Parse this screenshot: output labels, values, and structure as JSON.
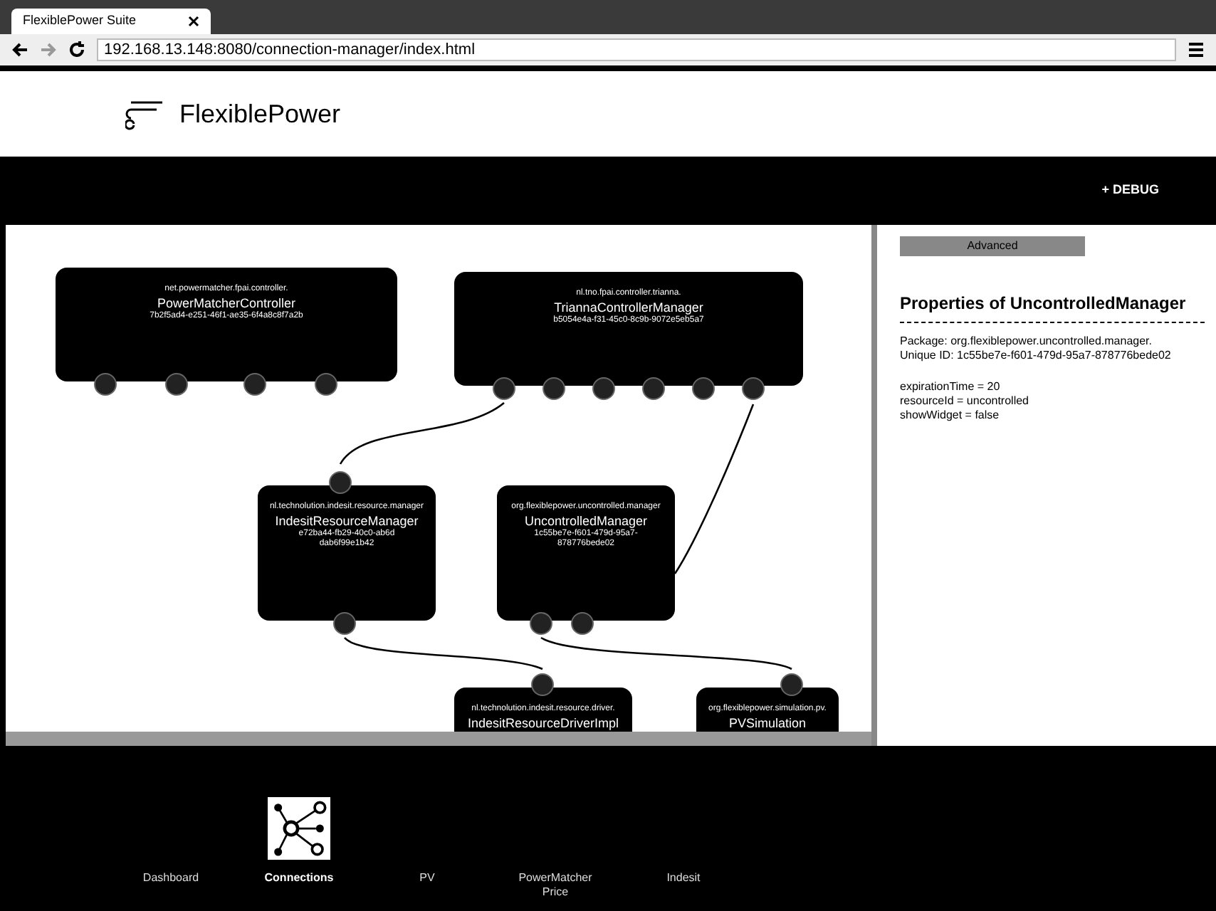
{
  "browser": {
    "tab_title": "FlexiblePower Suite",
    "address": "192.168.13.148:8080/connection-manager/index.html"
  },
  "header": {
    "logo_text": "FlexiblePower"
  },
  "toolbar": {
    "debug_link": "+ DEBUG"
  },
  "graph": {
    "nodes": [
      {
        "package": "net.powermatcher.fpai.controller.",
        "name": "PowerMatcherController",
        "id_lines": [
          "7b2f5ad4-e251-46f1-ae35-6f4a8c8f7a2b"
        ]
      },
      {
        "package": "nl.tno.fpai.controller.trianna.",
        "name": "TriannaControllerManager",
        "id_lines": [
          "b5054e4a-f31-45c0-8c9b-9072e5eb5a7"
        ]
      },
      {
        "package": "nl.technolution.indesit.resource.manager",
        "name": "IndesitResourceManager",
        "id_lines": [
          "e72ba44-fb29-40c0-ab6d",
          "dab6f99e1b42"
        ]
      },
      {
        "package": "org.flexiblepower.uncontrolled.manager",
        "name": "UncontrolledManager",
        "id_lines": [
          "1c55be7e-f601-479d-95a7-",
          "878776bede02"
        ]
      },
      {
        "package": "nl.technolution.indesit.resource.driver.",
        "name": "IndesitResourceDriverImpl"
      },
      {
        "package": "org.flexiblepower.simulation.pv.",
        "name": "PVSimulation"
      }
    ]
  },
  "properties": {
    "button": "Advanced",
    "title": "Properties of UncontrolledManager",
    "info_lines": [
      "Package: org.flexiblepower.uncontrolled.manager.",
      "Unique ID: 1c55be7e-f601-479d-95a7-878776bede02"
    ],
    "values": [
      "expirationTime = 20",
      "resourceId = uncontrolled",
      "showWidget = false"
    ]
  },
  "nav": [
    {
      "label": "Dashboard",
      "selected": false
    },
    {
      "label": "Connections",
      "selected": true
    },
    {
      "label": "PV",
      "selected": false
    },
    {
      "label": "PowerMatcher Price",
      "selected": false
    },
    {
      "label": "Indesit",
      "selected": false
    }
  ]
}
